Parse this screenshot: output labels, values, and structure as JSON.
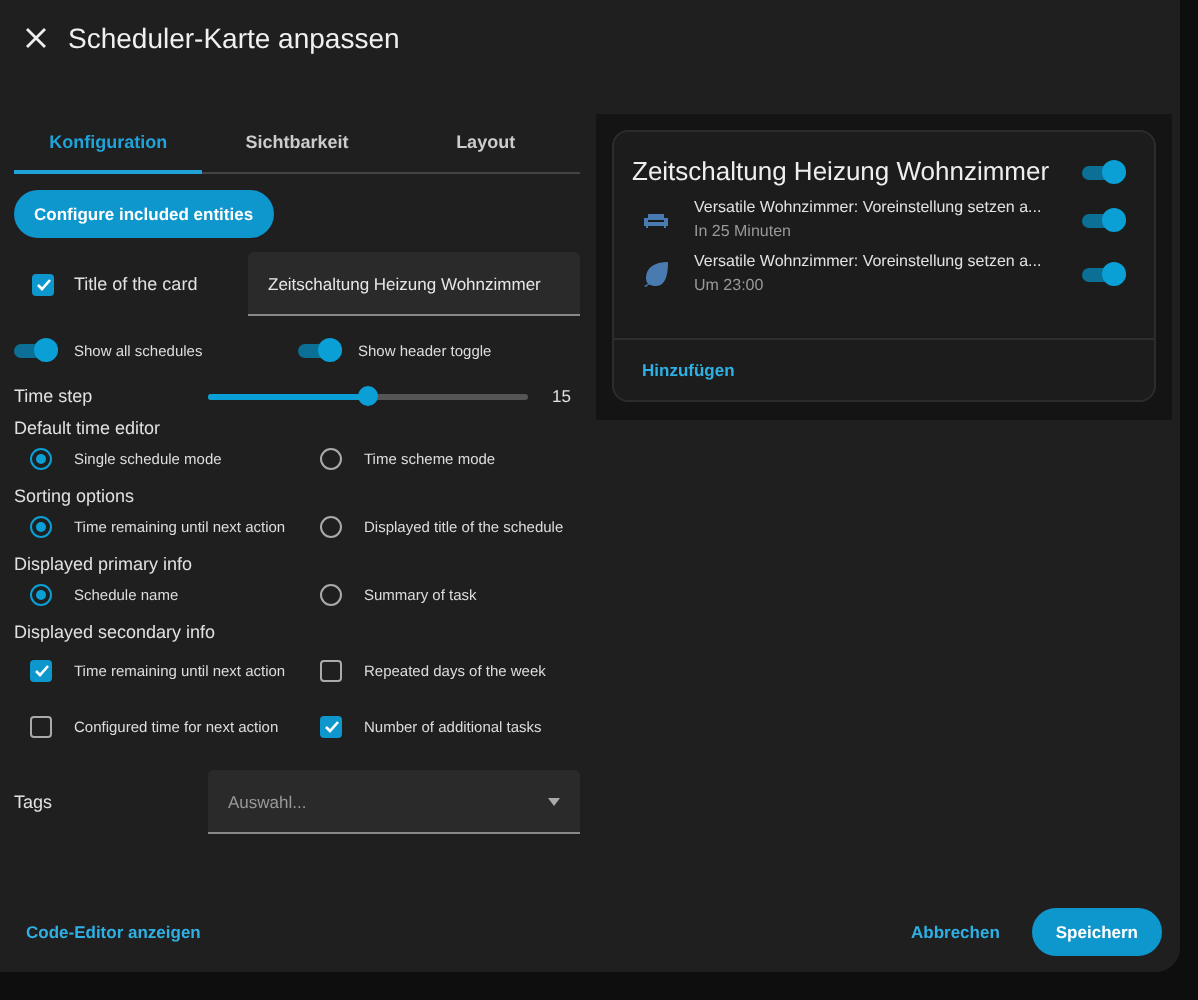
{
  "dialog": {
    "title": "Scheduler-Karte anpassen"
  },
  "tabs": [
    {
      "label": "Konfiguration",
      "selected": true
    },
    {
      "label": "Sichtbarkeit",
      "selected": false
    },
    {
      "label": "Layout",
      "selected": false
    }
  ],
  "configure_button": "Configure included entities",
  "card_title": {
    "label": "Title of the card",
    "checked": true,
    "value": "Zeitschaltung Heizung Wohnzimmer"
  },
  "toggles": [
    {
      "label": "Show all schedules",
      "on": true
    },
    {
      "label": "Show header toggle",
      "on": true
    }
  ],
  "time_step": {
    "label": "Time step",
    "level": 0.5,
    "reading": "15"
  },
  "sections": [
    {
      "kind": "radio",
      "heading": "Default time editor",
      "options": [
        {
          "label": "Single schedule mode",
          "selected": true
        },
        {
          "label": "Time scheme mode",
          "selected": false
        }
      ]
    },
    {
      "kind": "radio",
      "heading": "Sorting options",
      "options": [
        {
          "label": "Time remaining until next action",
          "selected": true
        },
        {
          "label": "Displayed title of the schedule",
          "selected": false
        }
      ]
    },
    {
      "kind": "radio",
      "heading": "Displayed primary info",
      "options": [
        {
          "label": "Schedule name",
          "selected": true
        },
        {
          "label": "Summary of task",
          "selected": false
        }
      ]
    },
    {
      "kind": "checkbox",
      "heading": "Displayed secondary info",
      "options": [
        {
          "label": "Time remaining until next action",
          "checked": true
        },
        {
          "label": "Repeated days of the week",
          "checked": false
        },
        {
          "label": "Configured time for next action",
          "checked": false
        },
        {
          "label": "Number of additional tasks",
          "checked": true
        }
      ]
    }
  ],
  "tags": {
    "label": "Tags",
    "placeholder": "Auswahl..."
  },
  "preview": {
    "title": "Zeitschaltung Heizung Wohnzimmer",
    "on": true,
    "items": [
      {
        "kind": "sofa",
        "primary": "Versatile Wohnzimmer: Voreinstellung setzen a...",
        "secondary": "In 25 Minuten",
        "on": true
      },
      {
        "kind": "leaf",
        "primary": "Versatile Wohnzimmer: Voreinstellung setzen a...",
        "secondary": "Um 23:00",
        "on": true
      }
    ],
    "add": "Hinzufügen"
  },
  "footer": {
    "code_editor": "Code-Editor anzeigen",
    "cancel": "Abbrechen",
    "save": "Speichern"
  }
}
